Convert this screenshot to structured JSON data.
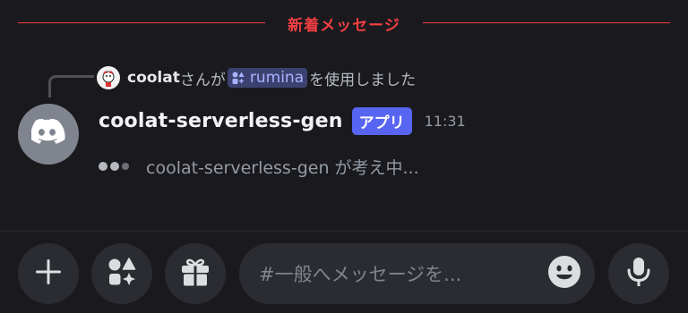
{
  "divider": {
    "label": "新着メッセージ",
    "color": "#f23f43"
  },
  "reference": {
    "username": "coolat",
    "text_before": "さんが",
    "command": "rumina",
    "text_after": "を使用しました"
  },
  "message": {
    "author": "coolat-serverless-gen",
    "badge": "アプリ",
    "timestamp": "11:31",
    "typing_text": "coolat-serverless-gen が考え中..."
  },
  "composer": {
    "placeholder": "#一般へメッセージを..."
  },
  "icons": {
    "avatar": "discord-logo-icon",
    "plus": "plus-icon",
    "apps": "apps-icon",
    "gift": "gift-icon",
    "emoji": "emoji-icon",
    "mic": "microphone-icon"
  },
  "colors": {
    "background": "#1a1a1e",
    "accent": "#5865f2",
    "mention_bg": "#3c4270",
    "mention_text": "#a8b3ff"
  }
}
